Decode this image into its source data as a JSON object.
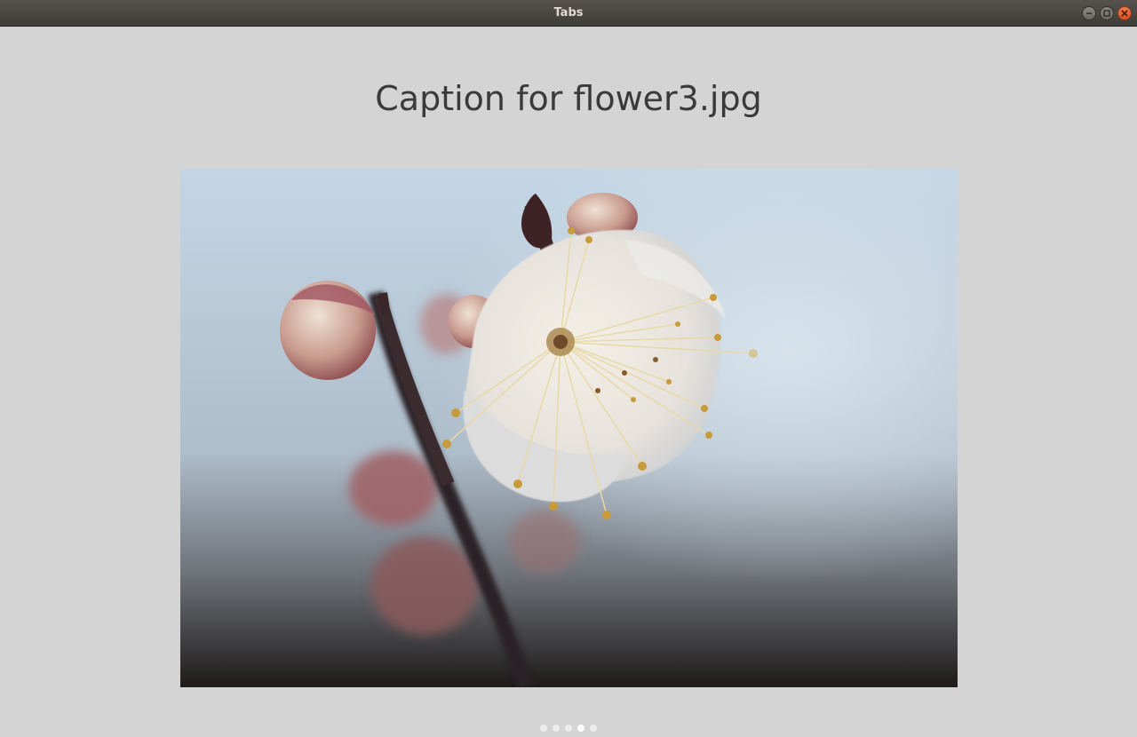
{
  "window": {
    "title": "Tabs",
    "controls": {
      "minimize_icon": "minimize-icon",
      "maximize_icon": "maximize-icon",
      "close_icon": "close-icon"
    }
  },
  "carousel": {
    "caption": "Caption for flower3.jpg",
    "image_alt": "flower3.jpg",
    "indicator": {
      "count": 5,
      "active_index": 3
    }
  },
  "colors": {
    "background": "#d4d4d4",
    "titlebar": "#4a4844",
    "close_button": "#e5622f",
    "caption_text": "#3a3a3a"
  }
}
